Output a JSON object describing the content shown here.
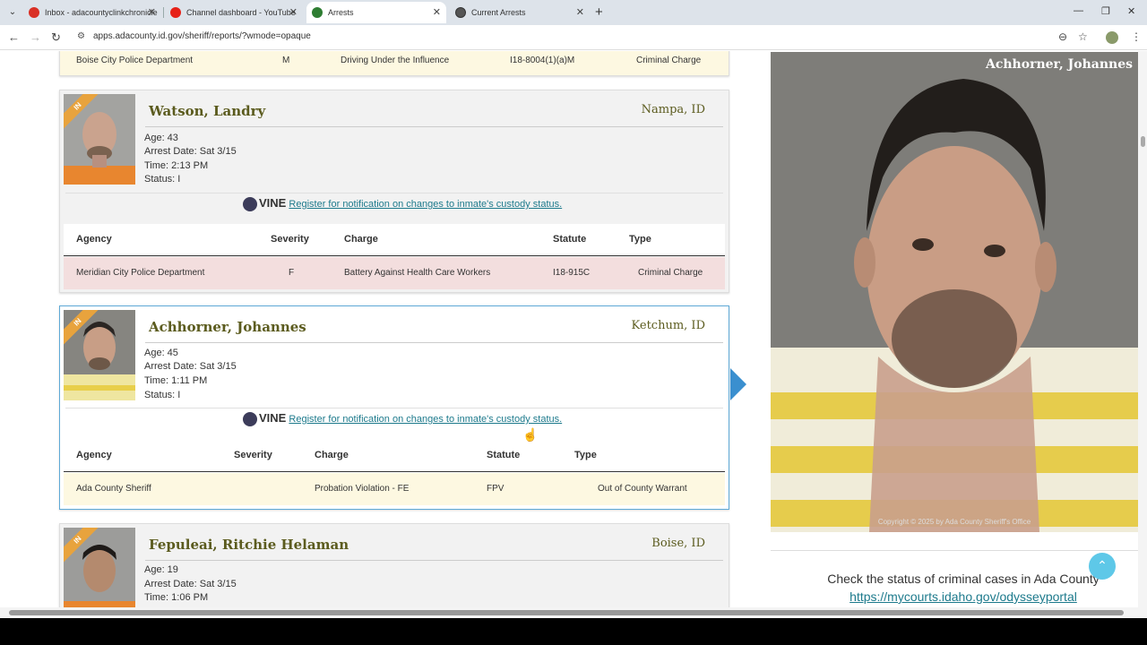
{
  "tabs": [
    {
      "title": "Inbox - adacountyclinkchronicle",
      "favicon_color": "#d93025"
    },
    {
      "title": "Channel dashboard - YouTube",
      "favicon_color": "#e62117"
    },
    {
      "title": "Arrests",
      "favicon_color": "#2e7d32"
    },
    {
      "title": "Current Arrests",
      "favicon_color": "#555555"
    }
  ],
  "new_tab": "+",
  "window_controls": {
    "minimize": "—",
    "restore": "❐",
    "close": "✕"
  },
  "toolbar": {
    "back": "←",
    "forward": "→",
    "reload": "↻",
    "url": "apps.adacounty.id.gov/sheriff/reports/?wmode=opaque",
    "zoom": "⊖",
    "star": "☆",
    "menu": "⋮"
  },
  "top_row": {
    "agency": "Boise City Police Department",
    "severity": "M",
    "charge": "Driving Under the Influence",
    "statute": "I18-8004(1)(a)M",
    "type": "Criminal Charge"
  },
  "vine": {
    "logo": "VINE",
    "link": "Register for notification on changes to inmate's custody status."
  },
  "table_headers": {
    "agency": "Agency",
    "severity": "Severity",
    "charge": "Charge",
    "statute": "Statute",
    "type": "Type"
  },
  "badge": "IN",
  "inmates": [
    {
      "name": "Watson, Landry",
      "city": "Nampa, ID",
      "age": "Age: 43",
      "arrest_date": "Arrest Date: Sat 3/15",
      "time": "Time: 2:13 PM",
      "status": "Status: I",
      "charge_row": {
        "agency": "Meridian City Police Department",
        "severity": "F",
        "charge": "Battery Against Health Care Workers",
        "statute": "I18-915C",
        "type": "Criminal Charge"
      }
    },
    {
      "name": "Achhorner, Johannes",
      "city": "Ketchum, ID",
      "age": "Age: 45",
      "arrest_date": "Arrest Date: Sat 3/15",
      "time": "Time: 1:11 PM",
      "status": "Status: I",
      "charge_row": {
        "agency": "Ada County Sheriff",
        "severity": "",
        "charge": "Probation Violation - FE",
        "statute": "FPV",
        "type": "Out of County Warrant"
      }
    },
    {
      "name": "Fepuleai, Ritchie Helaman",
      "city": "Boise, ID",
      "age": "Age: 19",
      "arrest_date": "Arrest Date: Sat 3/15",
      "time": "Time: 1:06 PM"
    }
  ],
  "mugshot": {
    "name": "Achhorner, Johannes",
    "copyright": "Copyright © 2025 by Ada County Sheriff's Office"
  },
  "courts": {
    "text": "Check the status of criminal cases in Ada County",
    "link": "https://mycourts.idaho.gov/odysseyportal"
  },
  "back_to_top": "⌃",
  "colors": {
    "accent": "#3a8fcf",
    "name_text": "#5b5b1e",
    "felony_row": "#f3dede",
    "warrant_row": "#fdf8e1",
    "badge": "#e8a33d"
  }
}
